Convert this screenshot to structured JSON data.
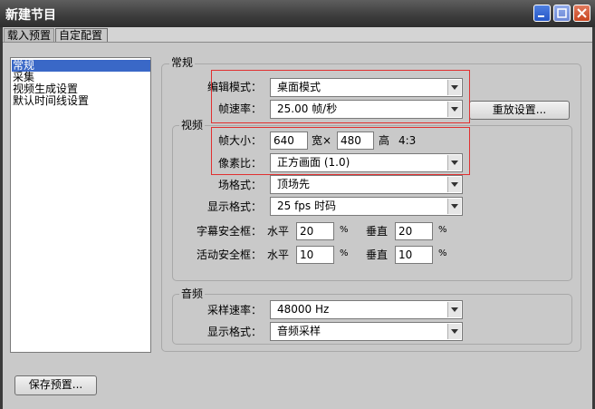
{
  "window": {
    "title": "新建节目"
  },
  "tabs": [
    {
      "label": "载入预置"
    },
    {
      "label": "自定配置"
    }
  ],
  "sidebar": {
    "items": [
      {
        "label": "常规",
        "selected": true
      },
      {
        "label": "采集"
      },
      {
        "label": "视频生成设置"
      },
      {
        "label": "默认时间线设置"
      }
    ]
  },
  "general": {
    "legend": "常规",
    "edit_mode_label": "编辑模式：",
    "edit_mode_value": "桌面模式",
    "timebase_label": "帧速率：",
    "timebase_value": "25.00 帧/秒",
    "reset_button": "重放设置..."
  },
  "video": {
    "legend": "视频",
    "frame_size_label": "帧大小：",
    "width_value": "640",
    "width_unit": "宽×",
    "height_value": "480",
    "height_unit": "高",
    "aspect_ratio": "4:3",
    "pixel_aspect_label": "像素比：",
    "pixel_aspect_value": "正方画面 (1.0)",
    "fields_label": "场格式：",
    "fields_value": "顶场先",
    "display_format_label": "显示格式：",
    "display_format_value": "25 fps 时码",
    "title_safe_label": "字幕安全框：",
    "title_safe_h_label": "水平",
    "title_safe_h_value": "20",
    "title_safe_v_label": "垂直",
    "title_safe_v_value": "20",
    "action_safe_label": "活动安全框：",
    "action_safe_h_label": "水平",
    "action_safe_h_value": "10",
    "action_safe_v_label": "垂直",
    "action_safe_v_value": "10",
    "percent": "%"
  },
  "audio": {
    "legend": "音频",
    "sample_rate_label": "采样速率：",
    "sample_rate_value": "48000 Hz",
    "display_format_label": "显示格式：",
    "display_format_value": "音频采样"
  },
  "footer": {
    "save_preset_button": "保存预置..."
  },
  "colors": {
    "highlight_box": "#e03030",
    "selection": "#3a68c7",
    "titlebar": "#3c3c3c"
  }
}
